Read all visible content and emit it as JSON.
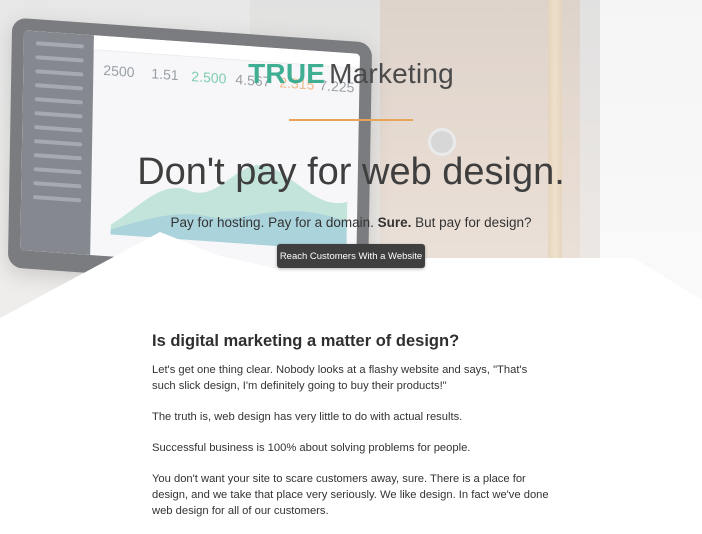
{
  "brand": {
    "true_text": "TRUE",
    "marketing_text": "Marketing",
    "accent_color": "#3fae93",
    "rule_color": "#e8a455"
  },
  "hero": {
    "headline": "Don't pay for web design.",
    "subline_part1": "Pay for hosting. Pay for a domain. ",
    "subline_bold": "Sure.",
    "subline_part2": " But pay for design?",
    "cta_label": "Reach Customers With a Website"
  },
  "article": {
    "title": "Is digital marketing a matter of design?",
    "paragraphs": [
      "Let's get one thing clear. Nobody looks at a flashy website and says, \"That's such slick design, I'm definitely going to buy their products!\"",
      "The truth is, web design has very little to do with actual results.",
      "Successful business is 100% about solving problems for people.",
      "You don't want your site to scare customers away, sure. There is a place for design, and we take that place very seriously. We like design. In fact we've done web design for all of our customers."
    ]
  },
  "background_screen": {
    "stats": [
      "2500",
      "1.51",
      "2.500",
      "4.567",
      "2.315",
      "7.225"
    ]
  }
}
